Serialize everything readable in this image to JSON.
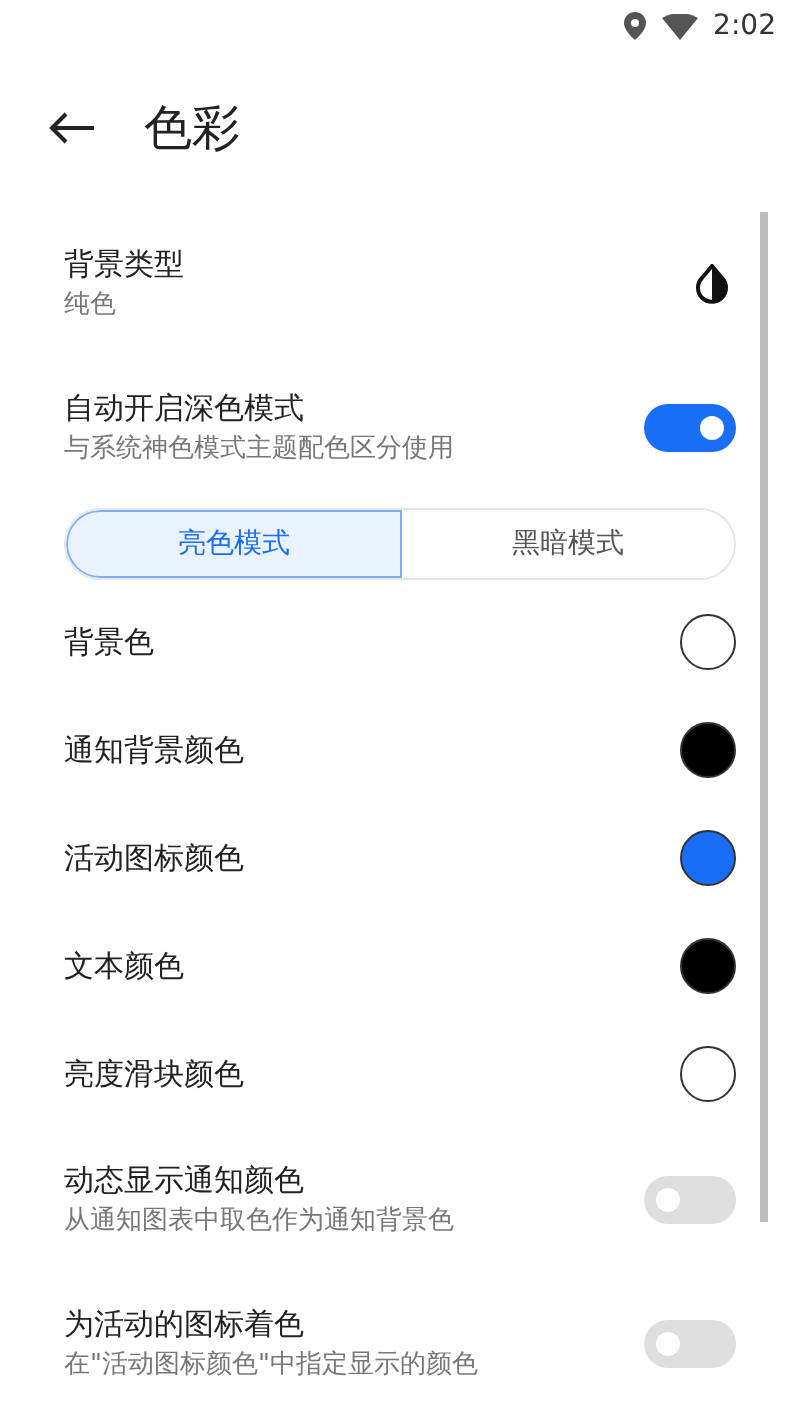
{
  "status_bar": {
    "time": "2:02"
  },
  "header": {
    "title": "色彩"
  },
  "settings": [
    {
      "kind": "icon",
      "title": "背景类型",
      "subtitle": "纯色"
    },
    {
      "kind": "toggle",
      "title": "自动开启深色模式",
      "subtitle": "与系统神色模式主题配色区分使用",
      "on": true
    },
    {
      "kind": "segmented",
      "options": [
        {
          "label": "亮色模式",
          "selected": true
        },
        {
          "label": "黑暗模式",
          "selected": false
        }
      ]
    },
    {
      "kind": "color",
      "title": "背景色",
      "color": "#ffffff"
    },
    {
      "kind": "color",
      "title": "通知背景颜色",
      "color": "#000000"
    },
    {
      "kind": "color",
      "title": "活动图标颜色",
      "color": "#1a6ef5"
    },
    {
      "kind": "color",
      "title": "文本颜色",
      "color": "#000000"
    },
    {
      "kind": "color",
      "title": "亮度滑块颜色",
      "color": "#ffffff"
    },
    {
      "kind": "toggle",
      "title": "动态显示通知颜色",
      "subtitle": "从通知图表中取色作为通知背景色",
      "on": false,
      "disabled": true
    },
    {
      "kind": "toggle",
      "title": "为活动的图标着色",
      "subtitle": "在\"活动图标颜色\"中指定显示的颜色",
      "on": false,
      "disabled": true
    }
  ]
}
